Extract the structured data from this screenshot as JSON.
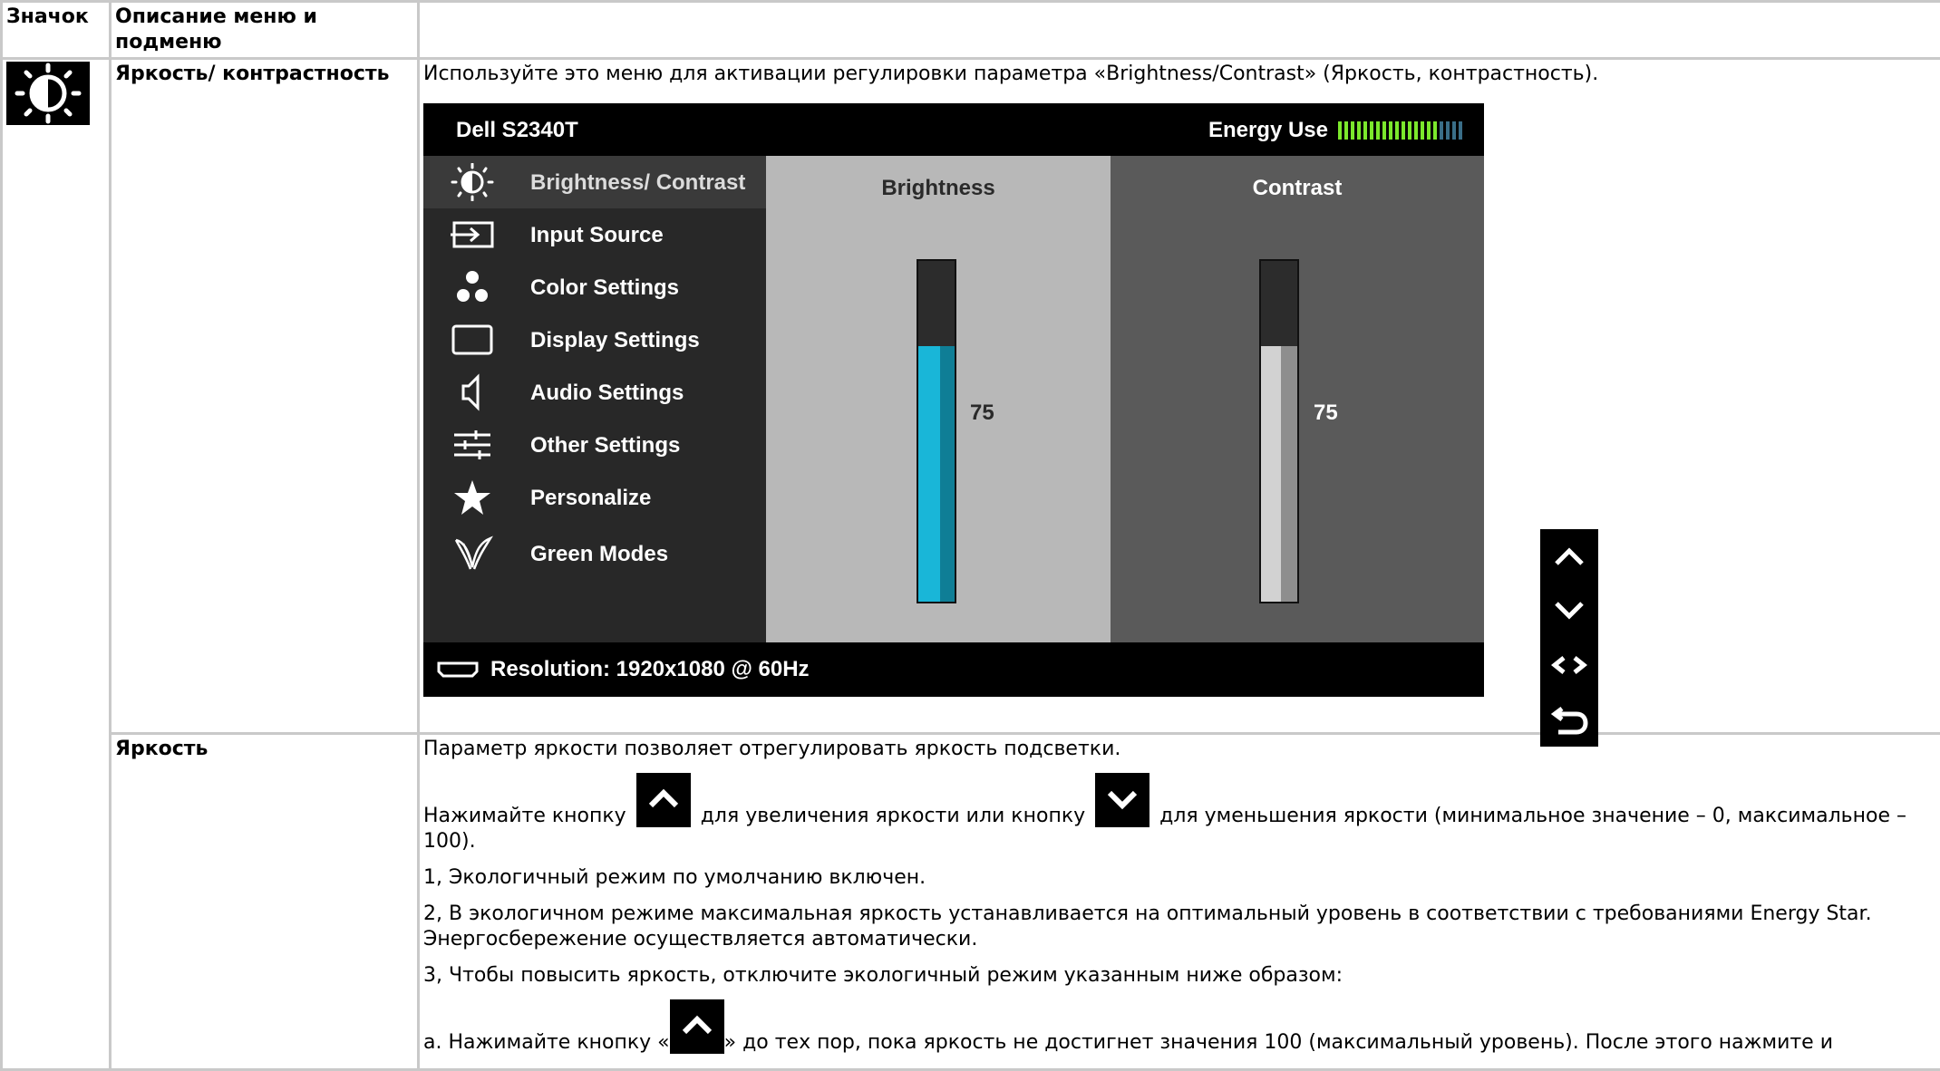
{
  "header": {
    "col_icon": "Значок",
    "col_desc": "Описание меню и подменю"
  },
  "row1": {
    "icon": "brightness-icon",
    "title": "Яркость/ контрастность",
    "text": "Используйте это меню для активации регулировки параметра «Brightness/Contrast» (Яркость, контрастность)."
  },
  "osd": {
    "model": "Dell S2340T",
    "energy_label": "Energy Use",
    "energy_level": 0.8,
    "menu": [
      {
        "label": "Brightness/ Contrast",
        "icon": "brightness-icon"
      },
      {
        "label": "Input Source",
        "icon": "input-source-icon"
      },
      {
        "label": "Color Settings",
        "icon": "color-settings-icon"
      },
      {
        "label": "Display Settings",
        "icon": "display-settings-icon"
      },
      {
        "label": "Audio Settings",
        "icon": "speaker-icon"
      },
      {
        "label": "Other Settings",
        "icon": "sliders-icon"
      },
      {
        "label": "Personalize",
        "icon": "star-icon"
      },
      {
        "label": "Green Modes",
        "icon": "green-modes-icon"
      }
    ],
    "brightness": {
      "title": "Brightness",
      "value": "75",
      "level": 75
    },
    "contrast": {
      "title": "Contrast",
      "value": "75",
      "level": 75
    },
    "resolution": "Resolution: 1920x1080 @ 60Hz",
    "buttons": [
      "up-arrow-icon",
      "down-arrow-icon",
      "left-right-icon",
      "back-icon"
    ]
  },
  "row2": {
    "title": "Яркость",
    "p1": "Параметр яркости позволяет отрегулировать яркость подсветки.",
    "p2_a": "Нажимайте кнопку",
    "p2_b": "для увеличения яркости или кнопку",
    "p2_c": "для уменьшения яркости (минимальное значение – 0, максимальное – 100).",
    "p3": "1, Экологичный режим по умолчанию включен.",
    "p4": "2, В экологичном режиме максимальная яркость устанавливается на оптимальный уровень в соответствии с требованиями Energy Star. Энергосбережение осуществляется автоматически.",
    "p5": "3, Чтобы повысить яркость, отключите экологичный режим указанным ниже образом:",
    "p6_a": "a. Нажимайте кнопку «",
    "p6_b": "» до тех пор, пока яркость не достигнет значения 100 (максимальный уровень). После этого нажмите и"
  }
}
